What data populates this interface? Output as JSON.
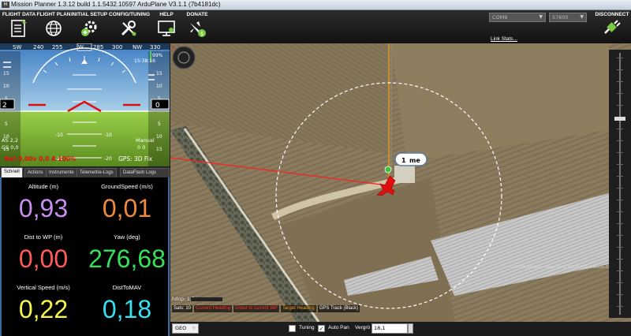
{
  "window": {
    "title": "Mission Planner 1.3.12 build 1.1.5432.10597 ArduPlane V3.1.1 (7b4181dc)"
  },
  "menu": [
    {
      "label": "FLIGHT DATA",
      "icon": "flight-data-icon"
    },
    {
      "label": "FLIGHT PLAN",
      "icon": "globe-icon"
    },
    {
      "label": "INITIAL SETUP",
      "icon": "gears-icon"
    },
    {
      "label": "CONFIG/TUNING",
      "icon": "wrench-icon"
    },
    {
      "label": "HELP",
      "icon": "monitor-icon"
    },
    {
      "label": "DONATE",
      "icon": "plane-dollar-icon"
    }
  ],
  "connection": {
    "port": "COM9",
    "baud": "57600",
    "link_stats": "Link Stats...",
    "disconnect_label": "DISCONNECT"
  },
  "hud": {
    "heading_scale": [
      "SW",
      "240",
      "255",
      "W",
      "285",
      "300",
      "NW",
      "330"
    ],
    "airspeed_scale": [
      "15",
      "10",
      "5",
      "0",
      "5",
      "10",
      "15"
    ],
    "airspeed_value": "2",
    "altitude_value": "0",
    "altitude_scale": [
      "15",
      "10",
      "5",
      "0",
      "5",
      "10",
      "15"
    ],
    "pitch_labels": [
      "-10",
      "-10",
      "-20",
      "-20"
    ],
    "battery_pct": "99%",
    "time": "15:38:16",
    "as_text": "AS 2,2",
    "gs_text": "GS 0,0",
    "mode": "Manual",
    "mode_sub": "0 0",
    "battery": "Bat 0,00v 0,0 A 100%",
    "gps": "GPS: 3D Fix",
    "colors": {
      "sky": "#7ab0d8",
      "ground": "#8cc63f",
      "horizon": "#ffffff",
      "hud_red": "#e01010"
    }
  },
  "tabs": [
    "Schnell",
    "Actions",
    "Instrumente",
    "Telemetrie-Logs",
    "DataFlash Logs"
  ],
  "quick": [
    {
      "label": "Altitude (m)",
      "value": "0,93",
      "color": "#c98ef0"
    },
    {
      "label": "GroundSpeed (m/s)",
      "value": "0,01",
      "color": "#f08a3c"
    },
    {
      "label": "Dist to WP (m)",
      "value": "0,00",
      "color": "#ff5a5a"
    },
    {
      "label": "Yaw (deg)",
      "value": "276,68",
      "color": "#34e05a"
    },
    {
      "label": "Vertical Speed (m/s)",
      "value": "0,22",
      "color": "#f6f64a"
    },
    {
      "label": "DistToMAV",
      "value": "0,18",
      "color": "#38e0f0"
    }
  ],
  "map": {
    "waypoint_label": "1",
    "waypoint_tag": "me",
    "hdop": "hdop: 1,7",
    "sats": "Sats: 10",
    "copyright": "©2014 Google · Map data ©2014 GeoBasis-DE/BKG",
    "legend": [
      {
        "label": "Current Heading",
        "color": "#ff3030"
      },
      {
        "label": "Direct to current WP",
        "color": "#ff3030"
      },
      {
        "label": "Target Heading",
        "color": "#f0a020"
      },
      {
        "label": "GPS Track (Black)",
        "color": "#ffffff"
      }
    ]
  },
  "bottom": {
    "projection": "GEO",
    "tuning_label": "Tuning",
    "tuning_checked": false,
    "autopan_label": "Auto Pan",
    "autopan_checked": true,
    "zoom_label": "Vergrö",
    "zoom_value": "18,1"
  }
}
